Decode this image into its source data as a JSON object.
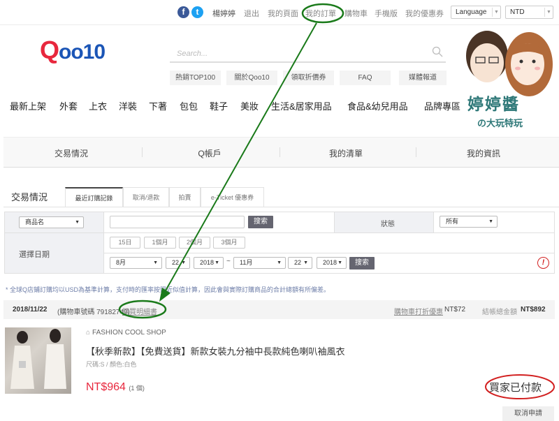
{
  "topbar": {
    "facebook_icon": "f",
    "twitter_icon": "t",
    "user_name": "楊婷婷",
    "links": [
      "退出",
      "我的頁面",
      "我的訂單",
      "購物車",
      "手機版",
      "我的優惠券"
    ],
    "language_select": "Language",
    "currency_select": "NTD"
  },
  "logo": {
    "q": "Q",
    "rest": "oo10"
  },
  "search": {
    "placeholder": "Search...",
    "quick_links": [
      "熱銷TOP100",
      "關於Qoo10",
      "領取折價券",
      "FAQ",
      "媒體報道"
    ]
  },
  "categories": [
    "最新上架",
    "外套",
    "上衣",
    "洋裝",
    "下著",
    "包包",
    "鞋子",
    "美妝",
    "生活&居家用品",
    "食品&幼兒用品",
    "品牌專區"
  ],
  "mascot": {
    "title": "婷婷醬",
    "subtitle": "の大玩特玩"
  },
  "account_tabs": [
    "交易情況",
    "Q帳戶",
    "我的清單",
    "我的資訊"
  ],
  "section_title": "交易情況",
  "sub_tabs": [
    "最近訂購記錄",
    "取消/退款",
    "拍賣",
    "e-Ticket 優惠券"
  ],
  "filter": {
    "field_select": "商品名",
    "search_input_value": "",
    "search_button": "搜索",
    "status_label": "狀態",
    "status_select": "所有",
    "date_label": "選擇日期",
    "quick_ranges": [
      "15日",
      "1個月",
      "2個月",
      "3個月"
    ],
    "from_month": "8月",
    "from_day": "22",
    "from_year": "2018",
    "range_sep": "~",
    "to_month": "11月",
    "to_day": "22",
    "to_year": "2018",
    "date_search_button": "搜索",
    "alert_icon": "!"
  },
  "notice": "* 全球Q店鋪訂購均以USD為基準計算，支付時的匯率按照近似值計算，因此會與實際訂購商品的合計總額有所偏差。",
  "order": {
    "date": "2018/11/22",
    "cart_no": "(購物車號碼 79182749)",
    "detail_link": "購買明細書",
    "discount_label": "購物車打折優惠",
    "discount_value": "NT$72",
    "total_label": "結帳總金額",
    "total_value": "NT$892",
    "item": {
      "shop": "FASHION COOL SHOP",
      "title": "【秋季新款】【免費送貨】新款女裝九分袖中長款純色喇叭袖風衣",
      "options": "尺碼:S / 顏色:白色",
      "price": "NT$964",
      "qty": "(1 個)",
      "status": "買家已付款",
      "cancel_button": "取消申請"
    }
  },
  "colors": {
    "brand_red": "#e8273d",
    "brand_blue": "#1b55b6",
    "annotation_green": "#1a7a1a",
    "annotation_red": "#d22020"
  }
}
